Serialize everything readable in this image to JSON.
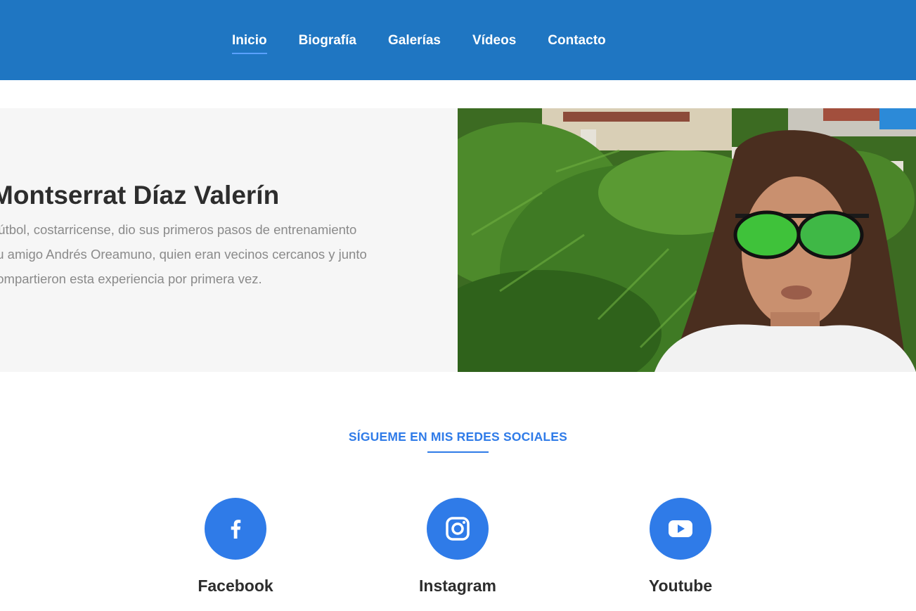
{
  "nav": {
    "items": [
      {
        "label": "Inicio",
        "active": true
      },
      {
        "label": "Biografía",
        "active": false
      },
      {
        "label": "Galerías",
        "active": false
      },
      {
        "label": "Vídeos",
        "active": false
      },
      {
        "label": "Contacto",
        "active": false
      }
    ]
  },
  "hero": {
    "title": "Montserrat Díaz Valerín",
    "description_lines": [
      "Fútbol, costarricense, dio sus primeros pasos de entrenamiento",
      "su amigo Andrés Oreamuno, quien eran vecinos cercanos y junto",
      "compartieron esta experiencia por primera vez."
    ],
    "image_icon": "portrait-photo"
  },
  "social": {
    "heading": "SÍGUEME EN MIS REDES SOCIALES",
    "items": [
      {
        "label": "Facebook",
        "icon": "facebook-icon"
      },
      {
        "label": "Instagram",
        "icon": "instagram-icon"
      },
      {
        "label": "Youtube",
        "icon": "youtube-icon"
      }
    ]
  },
  "colors": {
    "navbar": "#1f76c2",
    "accent": "#2f7be8",
    "hero_panel": "#f6f6f6",
    "heading_text": "#2d2d2d",
    "body_text": "#8a8a8a"
  }
}
